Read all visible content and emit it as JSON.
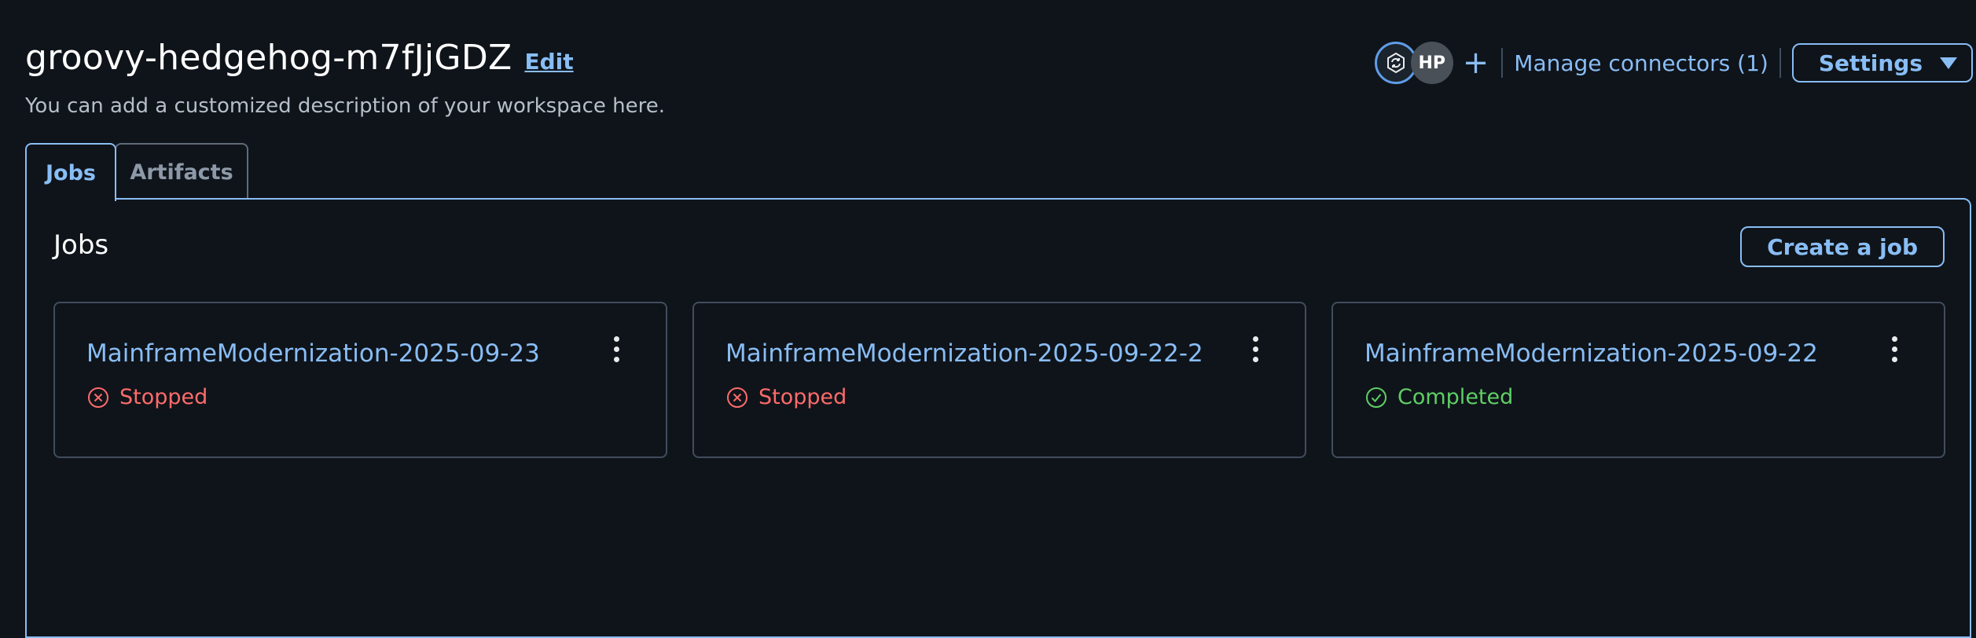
{
  "workspace": {
    "title": "groovy-hedgehog-m7fJjGDZ",
    "edit_label": "Edit",
    "description": "You can add a customized description of your workspace here."
  },
  "header": {
    "user_initials": "HP",
    "add_icon": "plus-icon",
    "agent_icon": "refresh-agent-icon",
    "manage_connectors_label": "Manage connectors (1)",
    "settings_label": "Settings"
  },
  "tabs": [
    {
      "label": "Jobs",
      "active": true
    },
    {
      "label": "Artifacts",
      "active": false
    }
  ],
  "jobs_panel": {
    "heading": "Jobs",
    "create_label": "Create a job",
    "cards": [
      {
        "title": "MainframeModernization-2025-09-23",
        "status": "Stopped",
        "status_icon": "x-circle-icon"
      },
      {
        "title": "MainframeModernization-2025-09-22-2",
        "status": "Stopped",
        "status_icon": "x-circle-icon"
      },
      {
        "title": "MainframeModernization-2025-09-22",
        "status": "Completed",
        "status_icon": "check-circle-icon"
      }
    ]
  },
  "colors": {
    "background": "#0f141a",
    "accent": "#89bdf5",
    "stopped": "#ff6b6b",
    "completed": "#5fcf65"
  }
}
